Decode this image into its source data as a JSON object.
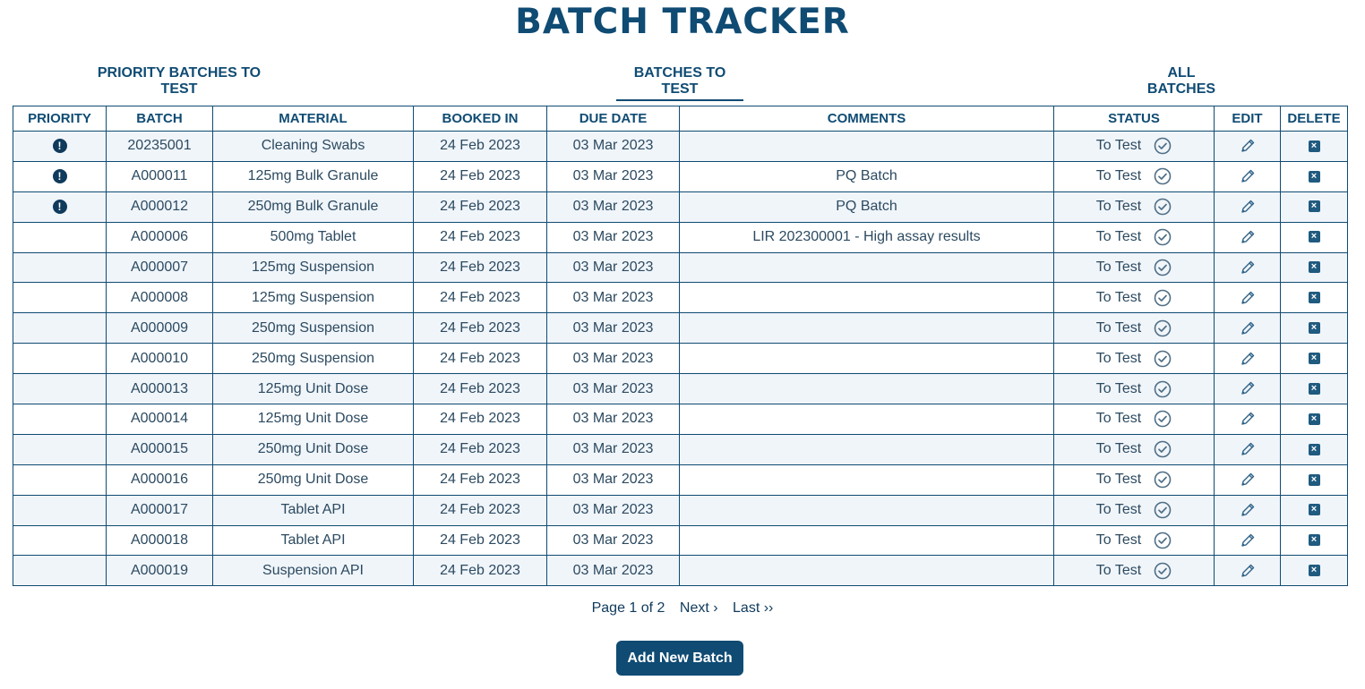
{
  "title": "BATCH TRACKER",
  "tabs": {
    "priority": "PRIORITY BATCHES TO TEST",
    "to_test": "BATCHES TO TEST",
    "all": "ALL BATCHES",
    "active": "to_test"
  },
  "table": {
    "columns": [
      "PRIORITY",
      "BATCH",
      "MATERIAL",
      "BOOKED IN",
      "DUE DATE",
      "COMMENTS",
      "STATUS",
      "EDIT",
      "DELETE"
    ],
    "rows": [
      {
        "priority": true,
        "batch": "20235001",
        "material": "Cleaning Swabs",
        "booked_in": "24 Feb 2023",
        "due_date": "03 Mar 2023",
        "comments": "",
        "status": "To Test"
      },
      {
        "priority": true,
        "batch": "A000011",
        "material": "125mg Bulk Granule",
        "booked_in": "24 Feb 2023",
        "due_date": "03 Mar 2023",
        "comments": "PQ Batch",
        "status": "To Test"
      },
      {
        "priority": true,
        "batch": "A000012",
        "material": "250mg Bulk Granule",
        "booked_in": "24 Feb 2023",
        "due_date": "03 Mar 2023",
        "comments": "PQ Batch",
        "status": "To Test"
      },
      {
        "priority": false,
        "batch": "A000006",
        "material": "500mg Tablet",
        "booked_in": "24 Feb 2023",
        "due_date": "03 Mar 2023",
        "comments": "LIR 202300001 - High assay results",
        "status": "To Test"
      },
      {
        "priority": false,
        "batch": "A000007",
        "material": "125mg Suspension",
        "booked_in": "24 Feb 2023",
        "due_date": "03 Mar 2023",
        "comments": "",
        "status": "To Test"
      },
      {
        "priority": false,
        "batch": "A000008",
        "material": "125mg Suspension",
        "booked_in": "24 Feb 2023",
        "due_date": "03 Mar 2023",
        "comments": "",
        "status": "To Test"
      },
      {
        "priority": false,
        "batch": "A000009",
        "material": "250mg Suspension",
        "booked_in": "24 Feb 2023",
        "due_date": "03 Mar 2023",
        "comments": "",
        "status": "To Test"
      },
      {
        "priority": false,
        "batch": "A000010",
        "material": "250mg Suspension",
        "booked_in": "24 Feb 2023",
        "due_date": "03 Mar 2023",
        "comments": "",
        "status": "To Test"
      },
      {
        "priority": false,
        "batch": "A000013",
        "material": "125mg Unit Dose",
        "booked_in": "24 Feb 2023",
        "due_date": "03 Mar 2023",
        "comments": "",
        "status": "To Test"
      },
      {
        "priority": false,
        "batch": "A000014",
        "material": "125mg Unit Dose",
        "booked_in": "24 Feb 2023",
        "due_date": "03 Mar 2023",
        "comments": "",
        "status": "To Test"
      },
      {
        "priority": false,
        "batch": "A000015",
        "material": "250mg Unit Dose",
        "booked_in": "24 Feb 2023",
        "due_date": "03 Mar 2023",
        "comments": "",
        "status": "To Test"
      },
      {
        "priority": false,
        "batch": "A000016",
        "material": "250mg Unit Dose",
        "booked_in": "24 Feb 2023",
        "due_date": "03 Mar 2023",
        "comments": "",
        "status": "To Test"
      },
      {
        "priority": false,
        "batch": "A000017",
        "material": "Tablet API",
        "booked_in": "24 Feb 2023",
        "due_date": "03 Mar 2023",
        "comments": "",
        "status": "To Test"
      },
      {
        "priority": false,
        "batch": "A000018",
        "material": "Tablet API",
        "booked_in": "24 Feb 2023",
        "due_date": "03 Mar 2023",
        "comments": "",
        "status": "To Test"
      },
      {
        "priority": false,
        "batch": "A000019",
        "material": "Suspension API",
        "booked_in": "24 Feb 2023",
        "due_date": "03 Mar 2023",
        "comments": "",
        "status": "To Test"
      }
    ]
  },
  "icons": {
    "priority": "exclamation-circle-icon",
    "status": "check-circle-icon",
    "edit": "pencil-icon",
    "delete": "close-box-icon"
  },
  "pagination": {
    "page_text": "Page 1 of 2",
    "next": "Next ›",
    "last": "Last ››"
  },
  "add_button": "Add New Batch",
  "colors": {
    "brand": "#0f4b73",
    "row_alt": "#f0f5fa"
  }
}
